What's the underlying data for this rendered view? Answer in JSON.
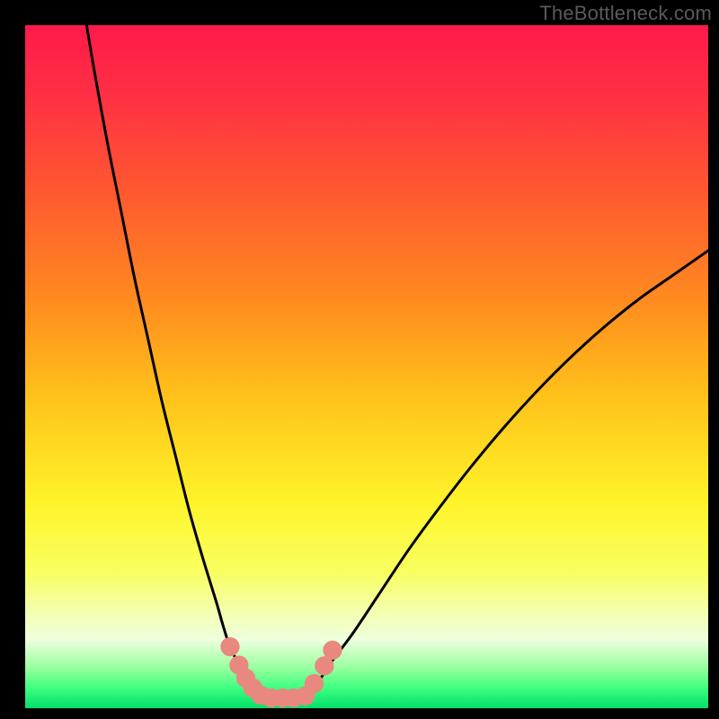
{
  "watermark": "TheBottleneck.com",
  "chart_data": {
    "type": "line",
    "title": "",
    "xlabel": "",
    "ylabel": "",
    "xlim": [
      0,
      100
    ],
    "ylim": [
      0,
      100
    ],
    "grid": false,
    "legend": false,
    "gradient_stops": [
      {
        "pos": 0.0,
        "color": "#ff1a4a"
      },
      {
        "pos": 0.1,
        "color": "#ff2f44"
      },
      {
        "pos": 0.25,
        "color": "#ff5a2f"
      },
      {
        "pos": 0.4,
        "color": "#ff8a1f"
      },
      {
        "pos": 0.55,
        "color": "#ffc41a"
      },
      {
        "pos": 0.7,
        "color": "#fff42a"
      },
      {
        "pos": 0.8,
        "color": "#f8ff60"
      },
      {
        "pos": 0.86,
        "color": "#f4ffb0"
      },
      {
        "pos": 0.9,
        "color": "#eeffdd"
      },
      {
        "pos": 0.94,
        "color": "#9affa0"
      },
      {
        "pos": 0.97,
        "color": "#3fff80"
      },
      {
        "pos": 1.0,
        "color": "#00e06a"
      }
    ],
    "series": [
      {
        "name": "curve-left",
        "x": [
          9,
          10,
          12,
          14,
          16,
          18,
          20,
          22,
          24,
          26,
          28,
          29,
          30,
          31.5,
          33,
          34.5
        ],
        "y": [
          100,
          94,
          83,
          73,
          63,
          54,
          45,
          37,
          29,
          22,
          15.5,
          12,
          9,
          6,
          3.5,
          1.5
        ]
      },
      {
        "name": "curve-right",
        "x": [
          41,
          43,
          45,
          48,
          52,
          56,
          60,
          65,
          70,
          75,
          80,
          85,
          90,
          95,
          100
        ],
        "y": [
          1.5,
          4,
          7,
          11,
          17,
          23,
          28.5,
          35,
          41,
          46.5,
          51.5,
          56,
          60,
          63.5,
          67
        ]
      }
    ],
    "flat_bottom": {
      "x0": 34.5,
      "x1": 41,
      "y": 1.5
    },
    "markers": [
      {
        "cx": 30.0,
        "cy": 9.0,
        "r": 1.4
      },
      {
        "cx": 31.3,
        "cy": 6.3,
        "r": 1.4
      },
      {
        "cx": 32.3,
        "cy": 4.4,
        "r": 1.4
      },
      {
        "cx": 33.3,
        "cy": 3.0,
        "r": 1.4
      },
      {
        "cx": 34.5,
        "cy": 1.9,
        "r": 1.4
      },
      {
        "cx": 36.0,
        "cy": 1.5,
        "r": 1.4
      },
      {
        "cx": 37.7,
        "cy": 1.5,
        "r": 1.4
      },
      {
        "cx": 39.3,
        "cy": 1.5,
        "r": 1.4
      },
      {
        "cx": 41.0,
        "cy": 1.8,
        "r": 1.4
      },
      {
        "cx": 42.3,
        "cy": 3.6,
        "r": 1.4
      },
      {
        "cx": 43.8,
        "cy": 6.2,
        "r": 1.4
      },
      {
        "cx": 45.0,
        "cy": 8.5,
        "r": 1.4
      }
    ],
    "marker_color": "#e8887f",
    "curve_color": "#000000"
  }
}
